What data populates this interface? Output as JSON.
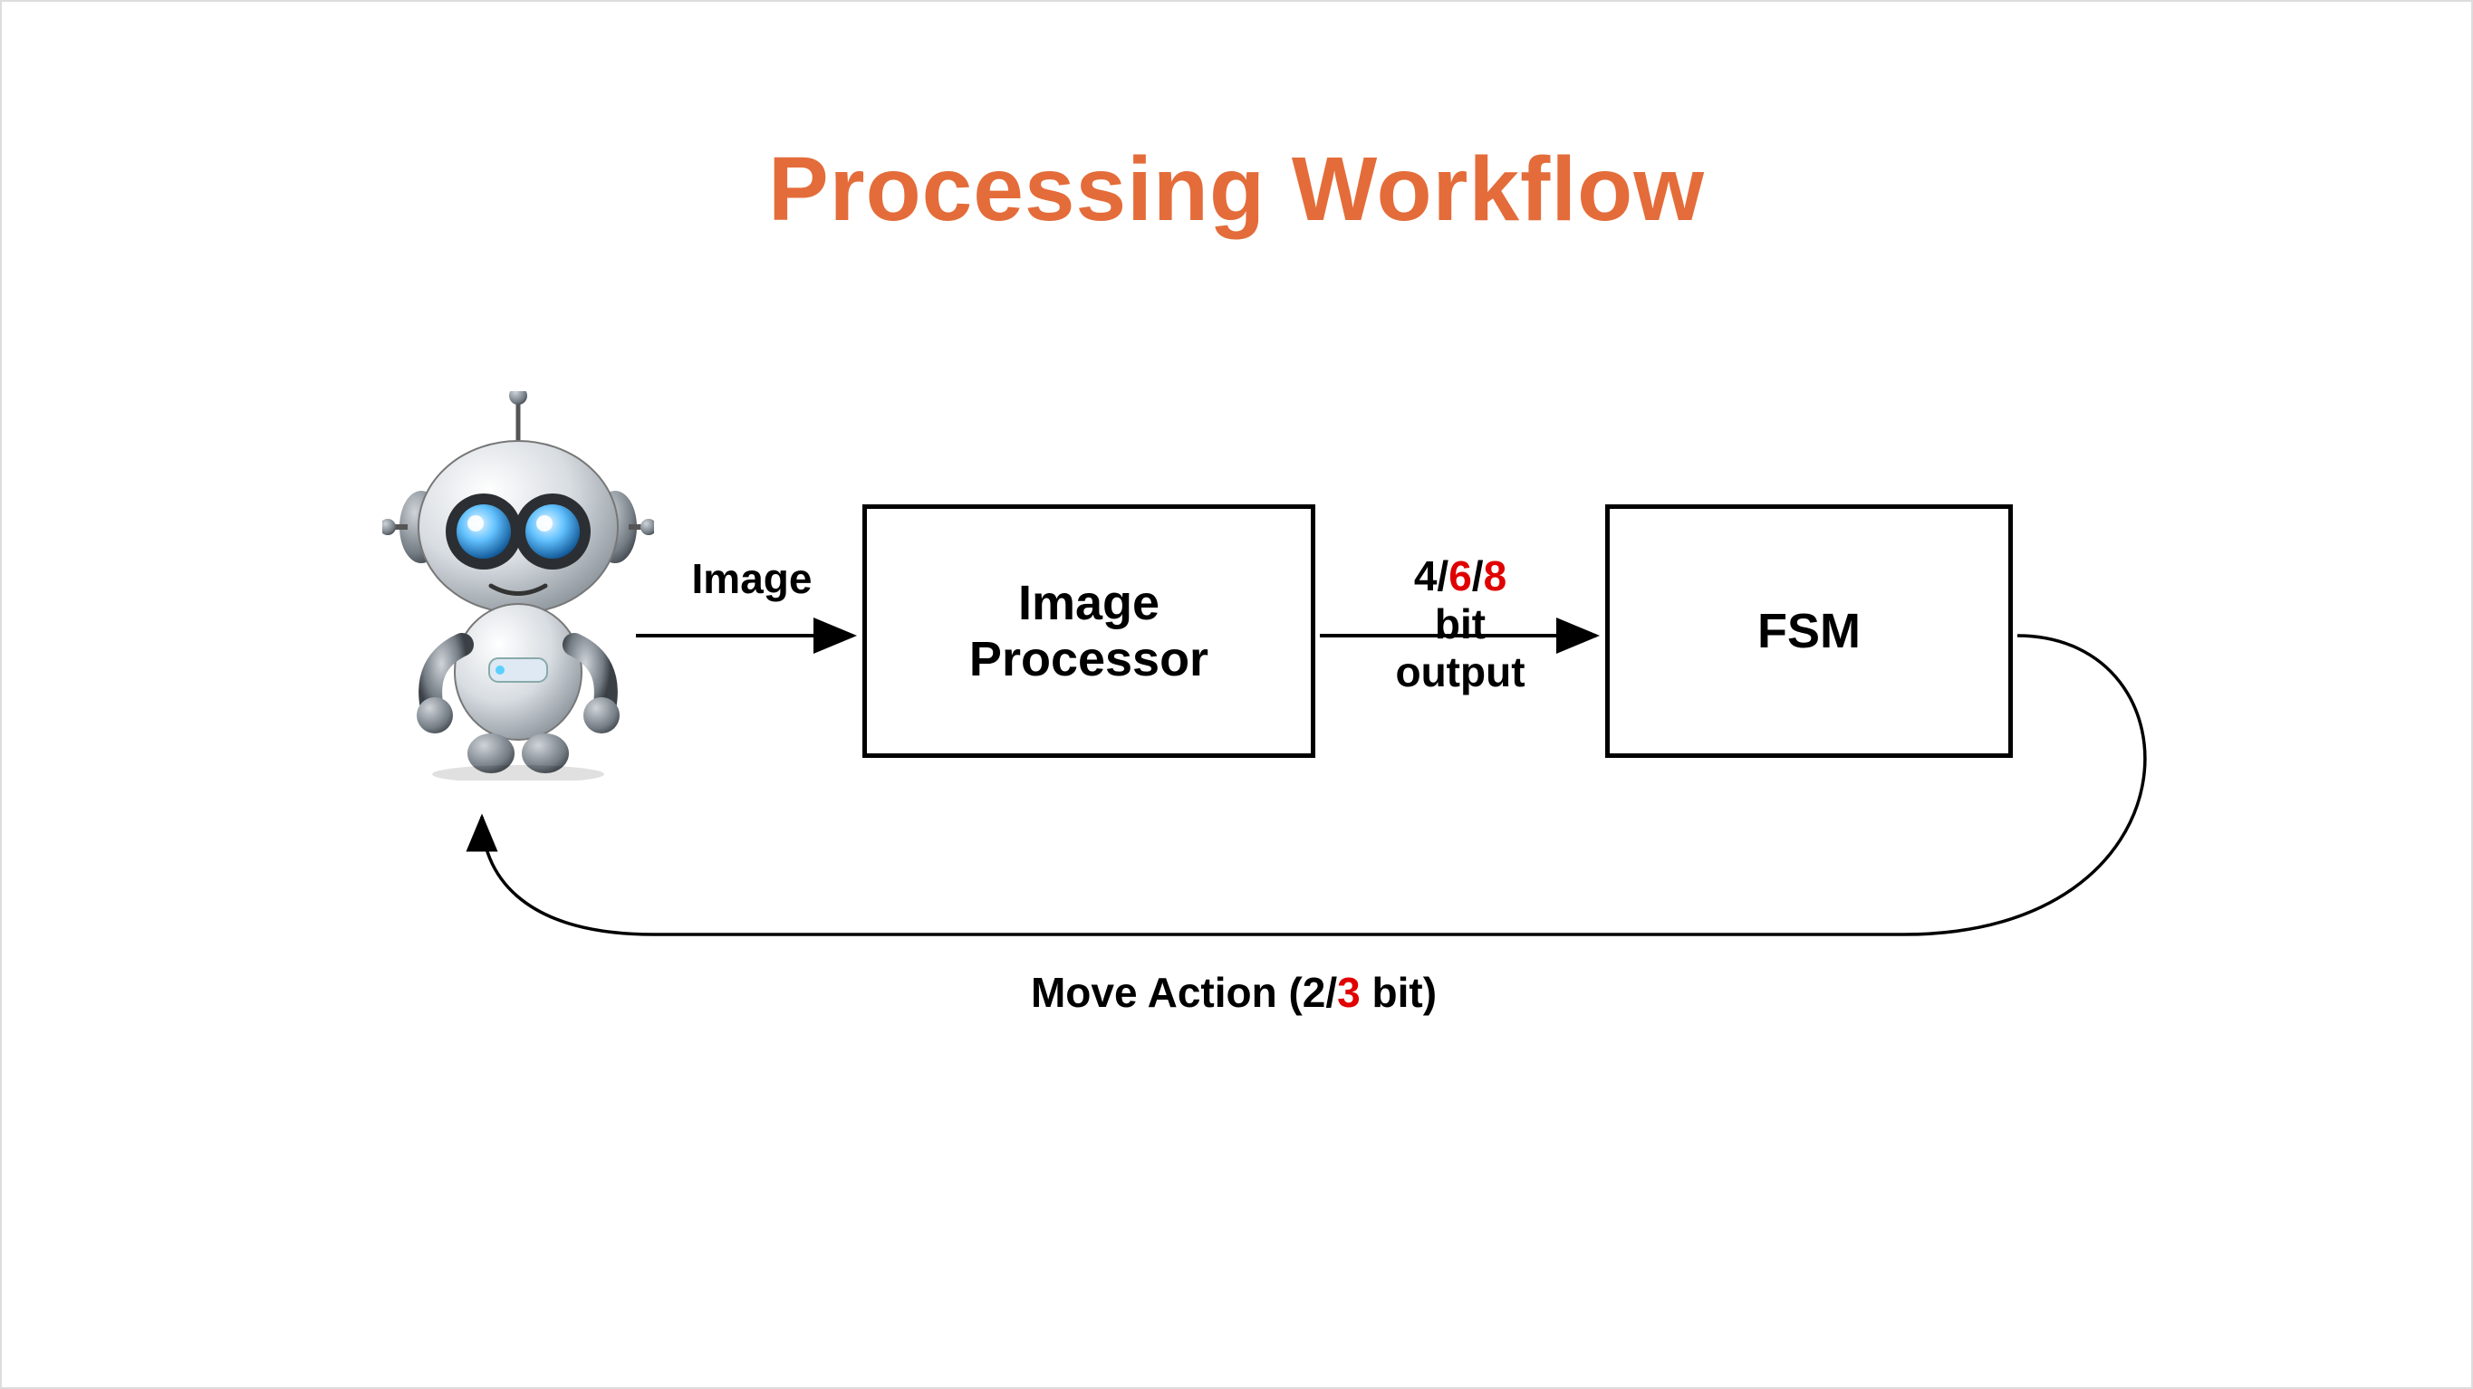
{
  "title": "Processing Workflow",
  "robot_icon": "robot-icon",
  "nodes": {
    "image_processor": {
      "line1": "Image",
      "line2": "Processor"
    },
    "fsm": {
      "label": "FSM"
    }
  },
  "edges": {
    "robot_to_imgproc": {
      "label": "Image"
    },
    "imgproc_to_fsm": {
      "line1_parts": {
        "a": "4/",
        "b": "6",
        "c": "/",
        "d": "8"
      },
      "line2": "bit",
      "line3": "output"
    },
    "fsm_to_robot": {
      "prefix": "Move Action (2/",
      "highlight": "3",
      "suffix": " bit)"
    }
  }
}
